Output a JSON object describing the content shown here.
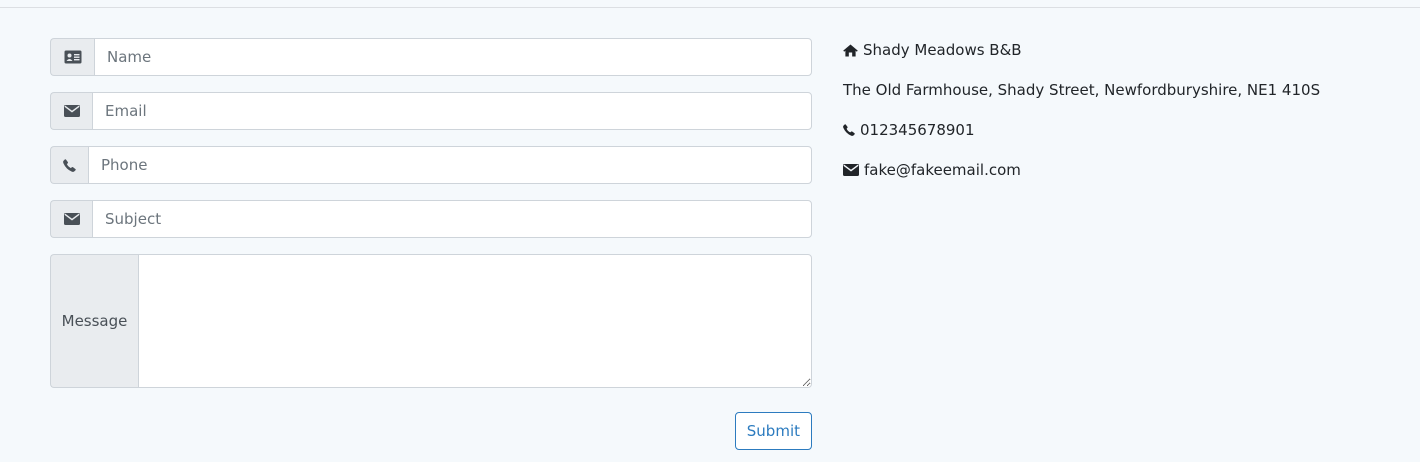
{
  "form": {
    "name_placeholder": "Name",
    "email_placeholder": "Email",
    "phone_placeholder": "Phone",
    "subject_placeholder": "Subject",
    "message_label": "Message",
    "submit_label": "Submit"
  },
  "contact": {
    "business_name": "Shady Meadows B&B",
    "address": "The Old Farmhouse, Shady Street, Newfordburyshire, NE1 410S",
    "phone": "012345678901",
    "email": "fake@fakeemail.com"
  },
  "icons": {
    "name": "id-card-icon",
    "email": "envelope-icon",
    "phone": "phone-icon",
    "subject": "envelope-icon",
    "business": "home-icon"
  },
  "colors": {
    "background": "#f5f9fc",
    "addon_background": "#e9ecef",
    "border": "#ced4da",
    "accent": "#2c7bbf"
  }
}
